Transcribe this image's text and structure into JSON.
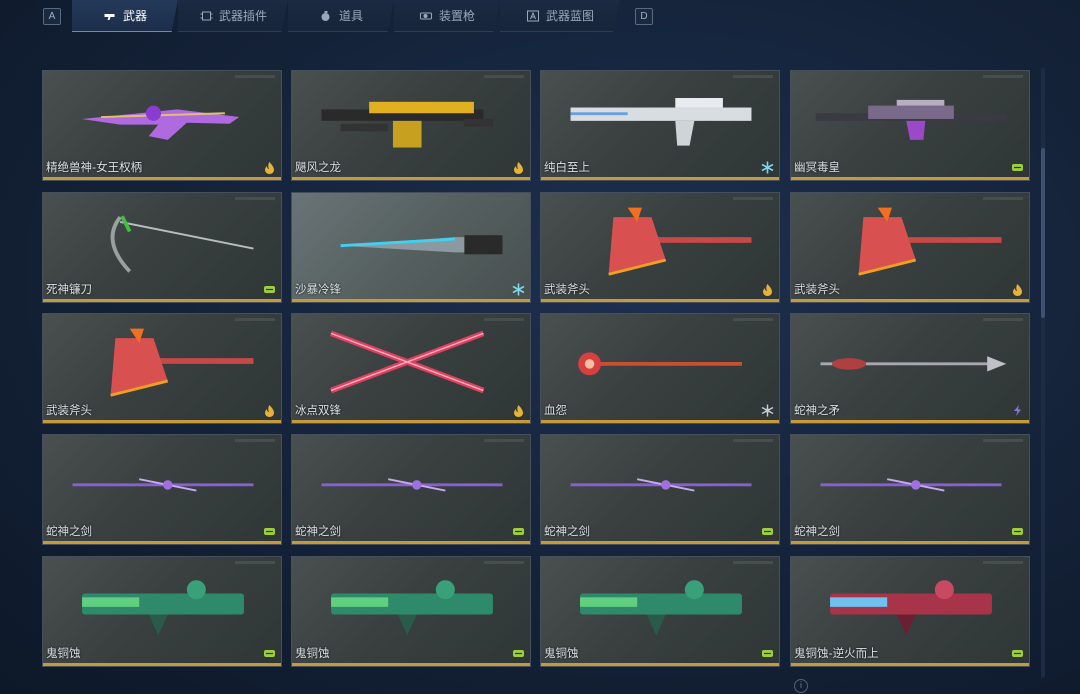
{
  "keys": {
    "left": "A",
    "right": "D"
  },
  "tabs": [
    {
      "label": "武器",
      "icon": "gun-icon",
      "active": true
    },
    {
      "label": "武器插件",
      "icon": "chip-icon",
      "active": false
    },
    {
      "label": "道具",
      "icon": "grenade-icon",
      "active": false
    },
    {
      "label": "装置枪",
      "icon": "device-gun-icon",
      "active": false
    },
    {
      "label": "武器蓝图",
      "icon": "blueprint-icon",
      "active": false
    }
  ],
  "colors": {
    "rarity_bar": "#c49a3a",
    "fire": "#e6b23a",
    "ice": "#7fd6e8",
    "green": "#9ecf3a",
    "purple": "#8a7ad8",
    "grey": "#c8cdd4"
  },
  "items": [
    {
      "name": "精绝兽神-女王权柄",
      "badge": "fire",
      "weapon": "purple-rifle"
    },
    {
      "name": "飓风之龙",
      "badge": "fire",
      "weapon": "gold-mg"
    },
    {
      "name": "纯白至上",
      "badge": "ice",
      "weapon": "white-rifle"
    },
    {
      "name": "幽冥毒皇",
      "badge": "green",
      "weapon": "dark-sniper"
    },
    {
      "name": "死神镰刀",
      "badge": "green",
      "weapon": "scythe"
    },
    {
      "name": "沙暴冷锋",
      "badge": "ice",
      "weapon": "knife"
    },
    {
      "name": "武装斧头",
      "badge": "fire",
      "weapon": "axe"
    },
    {
      "name": "武装斧头",
      "badge": "fire",
      "weapon": "axe"
    },
    {
      "name": "武装斧头",
      "badge": "fire",
      "weapon": "axe"
    },
    {
      "name": "冰点双锋",
      "badge": "fire",
      "weapon": "dual-blades"
    },
    {
      "name": "血怨",
      "badge": "grey",
      "weapon": "staff"
    },
    {
      "name": "蛇神之矛",
      "badge": "purple",
      "weapon": "spear"
    },
    {
      "name": "蛇神之剑",
      "badge": "green",
      "weapon": "sword"
    },
    {
      "name": "蛇神之剑",
      "badge": "green",
      "weapon": "sword"
    },
    {
      "name": "蛇神之剑",
      "badge": "green",
      "weapon": "sword"
    },
    {
      "name": "蛇神之剑",
      "badge": "green",
      "weapon": "sword"
    },
    {
      "name": "鬼铜蚀",
      "badge": "green",
      "weapon": "green-cannon"
    },
    {
      "name": "鬼铜蚀",
      "badge": "green",
      "weapon": "green-cannon"
    },
    {
      "name": "鬼铜蚀",
      "badge": "green",
      "weapon": "green-cannon"
    },
    {
      "name": "鬼铜蚀-逆火而上",
      "badge": "green",
      "weapon": "red-cannon"
    }
  ],
  "selected_index": 5,
  "info_icon": "info-icon"
}
